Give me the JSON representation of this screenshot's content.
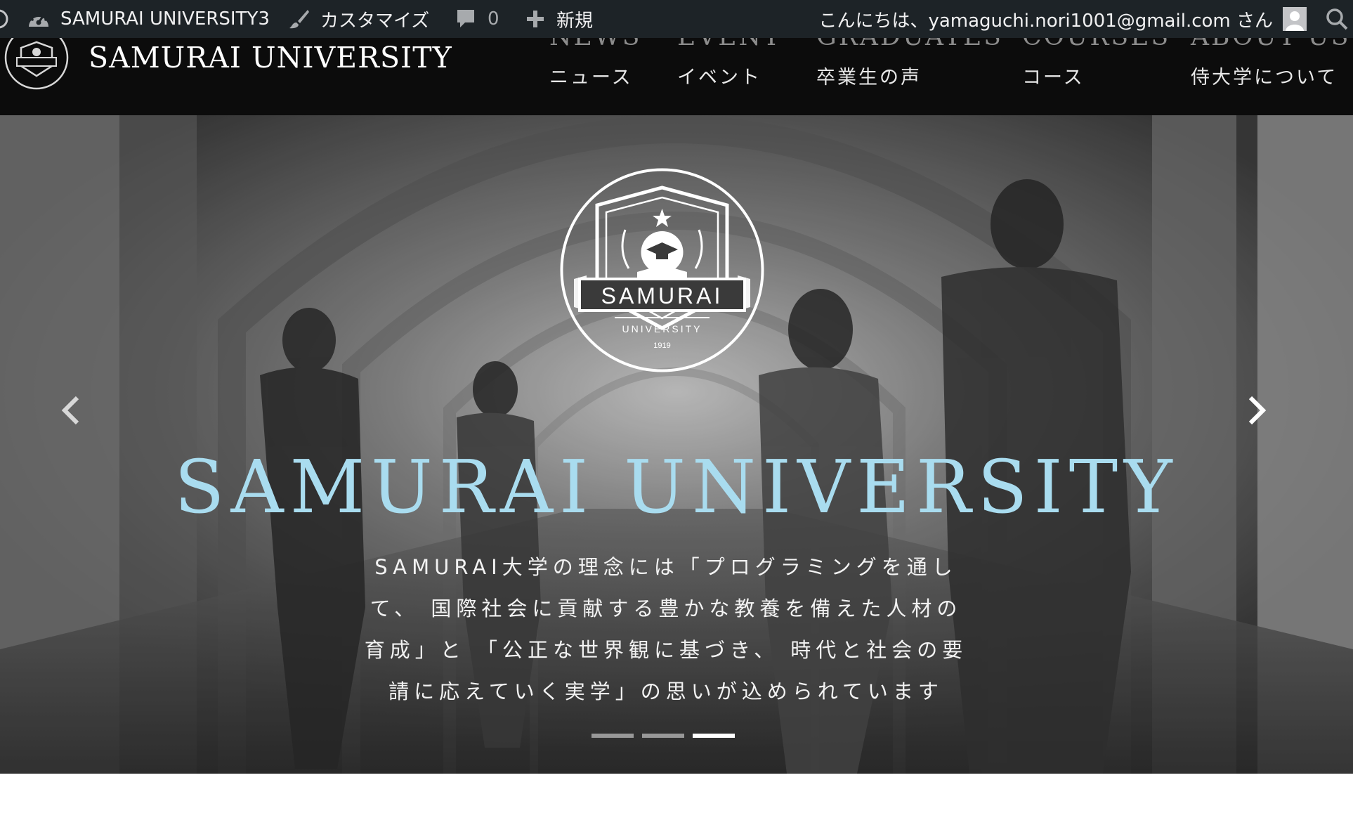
{
  "admin_bar": {
    "site_name": "SAMURAI UNIVERSITY3",
    "customize_label": "カスタマイズ",
    "comments_count": "0",
    "new_label": "新規",
    "greeting": "こんにちは、yamaguchi.nori1001@gmail.com さん"
  },
  "header": {
    "site_title": "SAMURAI UNIVERSITY",
    "nav": [
      {
        "en": "NEWS",
        "ja": "ニュース"
      },
      {
        "en": "EVENT",
        "ja": "イベント"
      },
      {
        "en": "GRADUATES",
        "ja": "卒業生の声"
      },
      {
        "en": "COURSES",
        "ja": "コース"
      },
      {
        "en": "ABOUT US",
        "ja": "侍大学について"
      }
    ]
  },
  "hero": {
    "emblem": {
      "name": "SAMURAI",
      "sub": "UNIVERSITY",
      "year": "1919"
    },
    "title": "SAMURAI UNIVERSITY",
    "lines": [
      "SAMURAI大学の理念には「プログラミングを通し",
      "て、 国際社会に貢献する豊かな教養を備えた人材の",
      "育成」と 「公正な世界観に基づき、 時代と社会の要",
      "請に応えていく実学」の思いが込められています"
    ],
    "active_slide": 3,
    "slide_count": 3
  },
  "colors": {
    "admin_bar_bg": "#1d2327",
    "header_bg": "#0c0c0c",
    "hero_title": "#a9dcef"
  },
  "icons": [
    "wordpress-icon",
    "dashboard-icon",
    "brush-icon",
    "comment-icon",
    "plus-icon",
    "user-avatar-icon",
    "search-icon",
    "chevron-left-icon",
    "chevron-right-icon",
    "university-emblem-icon"
  ]
}
